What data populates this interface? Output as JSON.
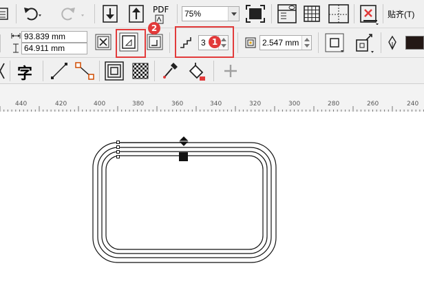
{
  "toolbar_top": {
    "zoom_value": "75%",
    "pdf_label": "PDF",
    "paste_label": "贴齐(T)",
    "icons": [
      "list-icon",
      "undo-icon",
      "redo-icon",
      "import-icon",
      "export-icon",
      "publish-pdf-icon",
      "full-screen-icon",
      "view-icon",
      "grid-icon",
      "guidelines-icon",
      "snap-off-icon"
    ]
  },
  "property_bar": {
    "width_value": "93.839 mm",
    "height_value": "64.911 mm",
    "contour_steps": "3",
    "contour_offset": "2.547 mm",
    "icons": [
      "to-center-icon",
      "inside-contour-icon",
      "outside-contour-icon",
      "steps-icon",
      "offset-icon",
      "corner-icon",
      "contour-acceleration-icon",
      "pen-icon"
    ]
  },
  "toolbox": {
    "text_tool_glyph": "字",
    "icons": [
      "text-icon",
      "line-icon",
      "connector-icon",
      "contour-icon",
      "transparency-icon",
      "eyedropper-icon",
      "fill-bucket-icon",
      "add-icon"
    ]
  },
  "annotations": {
    "badge1": "1",
    "badge2": "2"
  },
  "ruler": {
    "labels": [
      "440",
      "420",
      "400",
      "380",
      "360",
      "340",
      "320",
      "300",
      "280",
      "260",
      "240"
    ]
  },
  "colors": {
    "annotation_red": "#e23a3a",
    "toolbar_bg": "#f0f0f0"
  }
}
